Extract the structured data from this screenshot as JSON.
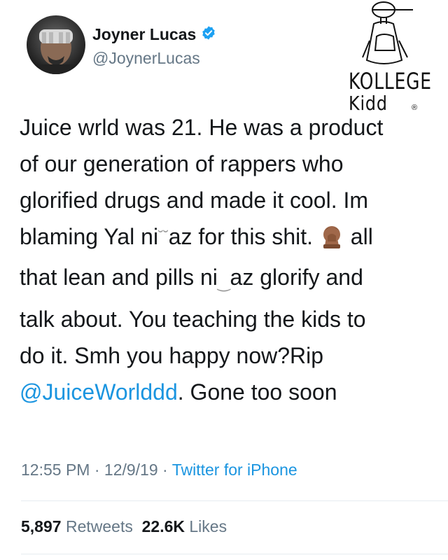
{
  "author": {
    "name": "Joyner Lucas",
    "handle": "@JoynerLucas",
    "verified": true
  },
  "watermark": {
    "line1": "KOLLEGE",
    "line2": "Kidd",
    "reg": "®"
  },
  "tweet": {
    "lines": [
      "Juice wrld was 21. He was a product",
      "of our generation of rappers who",
      "glorified drugs and made it cool. Im",
      "blaming Yal ni",
      "az for this shit.",
      "all",
      "that lean and pills ni",
      "az glorify and",
      "talk about. You teaching the kids to",
      "do it. Smh you happy now?Rip",
      "@JuiceWorlddd",
      ". Gone too soon"
    ]
  },
  "meta": {
    "time": "12:55 PM",
    "date": "12/9/19",
    "separator": "·",
    "source": "Twitter for iPhone"
  },
  "stats": {
    "retweets_count": "5,897",
    "retweets_label": "Retweets",
    "likes_count": "22.6K",
    "likes_label": "Likes"
  },
  "colors": {
    "link": "#1b95e0",
    "secondary_text": "#657786",
    "verified_badge": "#1da1f2"
  },
  "icons": [
    "verified-badge-icon",
    "facepalm-emoji-icon"
  ]
}
